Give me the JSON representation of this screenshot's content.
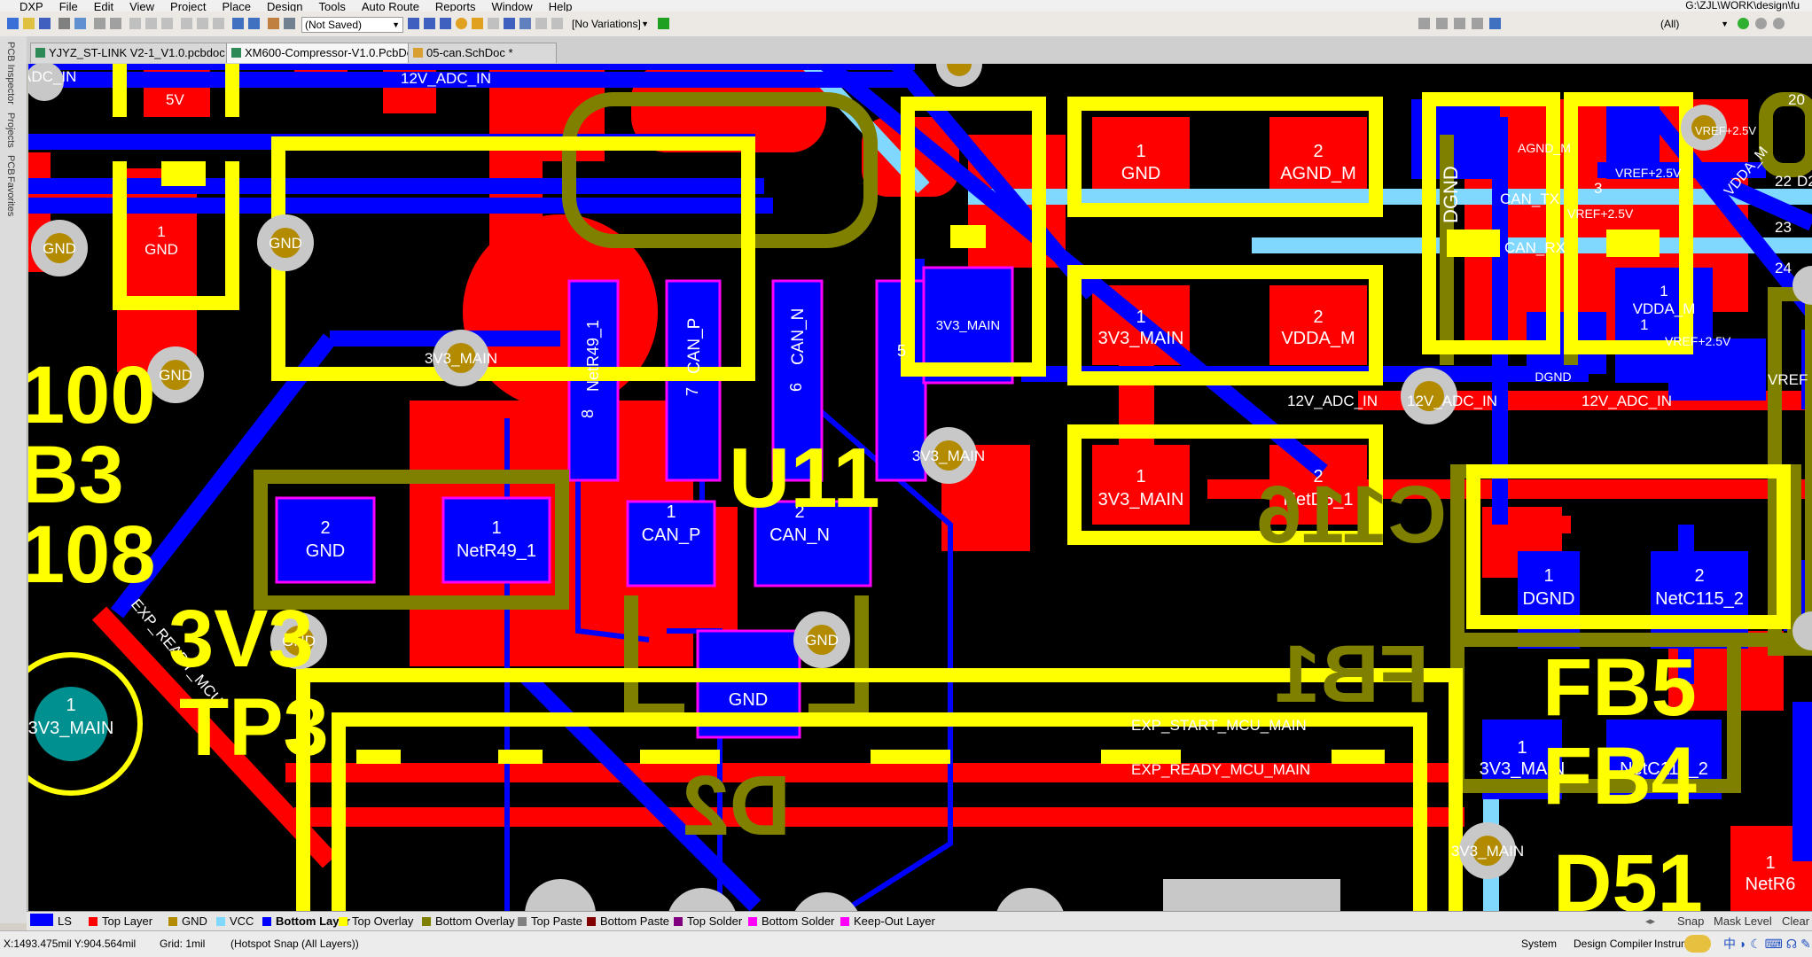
{
  "menu": {
    "items": [
      "DXP",
      "File",
      "Edit",
      "View",
      "Project",
      "Place",
      "Design",
      "Tools",
      "Auto Route",
      "Reports",
      "Window",
      "Help"
    ],
    "path": "G:\\ZJL\\WORK\\design\\fu"
  },
  "toolbar": {
    "save_status": "(Not Saved)",
    "variations": "[No Variations]",
    "filter": "(All)"
  },
  "panels": [
    "PCB Inspector",
    "Projects",
    "PCB",
    "Favorites"
  ],
  "tabs": [
    {
      "label": "YJYZ_ST-LINK V2-1_V1.0.pcbdoc *",
      "active": false
    },
    {
      "label": "XM600-Compressor-V1.0.PcbDoc",
      "active": true
    },
    {
      "label": "05-can.SchDoc *",
      "active": false
    }
  ],
  "pcb": {
    "silk": {
      "u11": "U11",
      "d51": "D51",
      "fb5": "FB5",
      "fb4": "FB4",
      "tp3": "TP3",
      "l1": "100",
      "l2": "B3",
      "l3": "108",
      "l4": "3V3",
      "mirror_d2": "D2",
      "mirror_c116": "C116",
      "mirror_fb1": "FB1"
    },
    "nets": {
      "adc_in_left": "ADC_IN",
      "adc_in_12v_top": "12V_ADC_IN",
      "v5": "5V",
      "gnd_pad": "GND",
      "gnd_via_1": "GND",
      "gnd_via_2": "GND",
      "gnd_via_3": "GND",
      "gnd_via_4": "GND",
      "gnd_via_5": "GND",
      "via_3v3_1": "3V3_MAIN",
      "via_3v3_2": "3V3_MAIN",
      "via_3v3_3": "3V3_MAIN",
      "netr49_vert": "NetR49_1",
      "pin8": "8",
      "can_p_vert": "CAN_P",
      "pin7": "7",
      "can_n_vert": "CAN_N",
      "pin6": "6",
      "pin5": "5",
      "pad_gnd_2": "GND",
      "pad_netr49": "NetR49_1",
      "pad_can_p": "CAN_P",
      "pad_can_n": "CAN_N",
      "pad_d2_gnd": "GND",
      "pad_tp3": "3V3_MAIN",
      "pad_3v3_main_small": "3V3_MAIN",
      "pad_r_gnd": "GND",
      "pad_agnd_m": "AGND_M",
      "pad_3v3_main_r2": "3V3_MAIN",
      "pad_vdda_m": "VDDA_M",
      "pad_3v3_main_r3": "3V3_MAIN",
      "pad_netd5": "NetD5_1",
      "trace_can_tx": "CAN_TX",
      "trace_can_rx": "CAN_RX",
      "dgnd_vert": "DGND",
      "agnd_m_small": "AGND_M",
      "vref_1": "VREF+2.5V",
      "vref_2": "VREF+2.5V",
      "vref_3": "VREF+2.5V",
      "vdda_m_pad2": "VDDA_M",
      "dgnd_small": "DGND",
      "adc12v_1": "12V_ADC_IN",
      "adc12v_2": "12V_ADC_IN",
      "adc12v_3": "12V_ADC_IN",
      "pad_dgnd_c115": "DGND",
      "pad_netc115": "NetC115_2",
      "pad_3v3_fb5": "3V3_MAIN",
      "pad_netc115_fb5": "NetC115_2",
      "via_3v3_fb4": "3V3_MAIN",
      "exp_start": "EXP_START_MCU_MAIN",
      "exp_ready": "EXP_READY_MCU_MAIN",
      "exp_ready_diag": "EXP_READY_MCU",
      "netr6": "NetR6",
      "vdda_diag": "VDDA_M",
      "d2_edge": "D2",
      "n22": "22",
      "n23": "23",
      "n24": "24",
      "n20": "20",
      "vref_edge": "VREF+2.5V",
      "vref_right": "VREF"
    }
  },
  "layers": [
    {
      "name": "LS",
      "color": "#0000ff",
      "active": false
    },
    {
      "name": "Top Layer",
      "color": "#ff0000",
      "active": false
    },
    {
      "name": "GND",
      "color": "#b38b00",
      "active": false
    },
    {
      "name": "VCC",
      "color": "#80d8ff",
      "active": false
    },
    {
      "name": "Bottom Layer",
      "color": "#0000ff",
      "active": true
    },
    {
      "name": "Top Overlay",
      "color": "#ffff00",
      "active": false
    },
    {
      "name": "Bottom Overlay",
      "color": "#808000",
      "active": false
    },
    {
      "name": "Top Paste",
      "color": "#808080",
      "active": false
    },
    {
      "name": "Bottom Paste",
      "color": "#800000",
      "active": false
    },
    {
      "name": "Top Solder",
      "color": "#800080",
      "active": false
    },
    {
      "name": "Bottom Solder",
      "color": "#ff00ff",
      "active": false
    },
    {
      "name": "Keep-Out Layer",
      "color": "#ff00ff",
      "active": false
    }
  ],
  "layer_controls": {
    "snap": "Snap",
    "mask_level": "Mask Level",
    "clear": "Clear"
  },
  "status": {
    "coords": "X:1493.475mil Y:904.564mil",
    "grid": "Grid: 1mil",
    "snap": "(Hotspot Snap (All Layers))",
    "system": "System",
    "design_compiler": "Design Compiler",
    "instruments": "Instrum"
  }
}
